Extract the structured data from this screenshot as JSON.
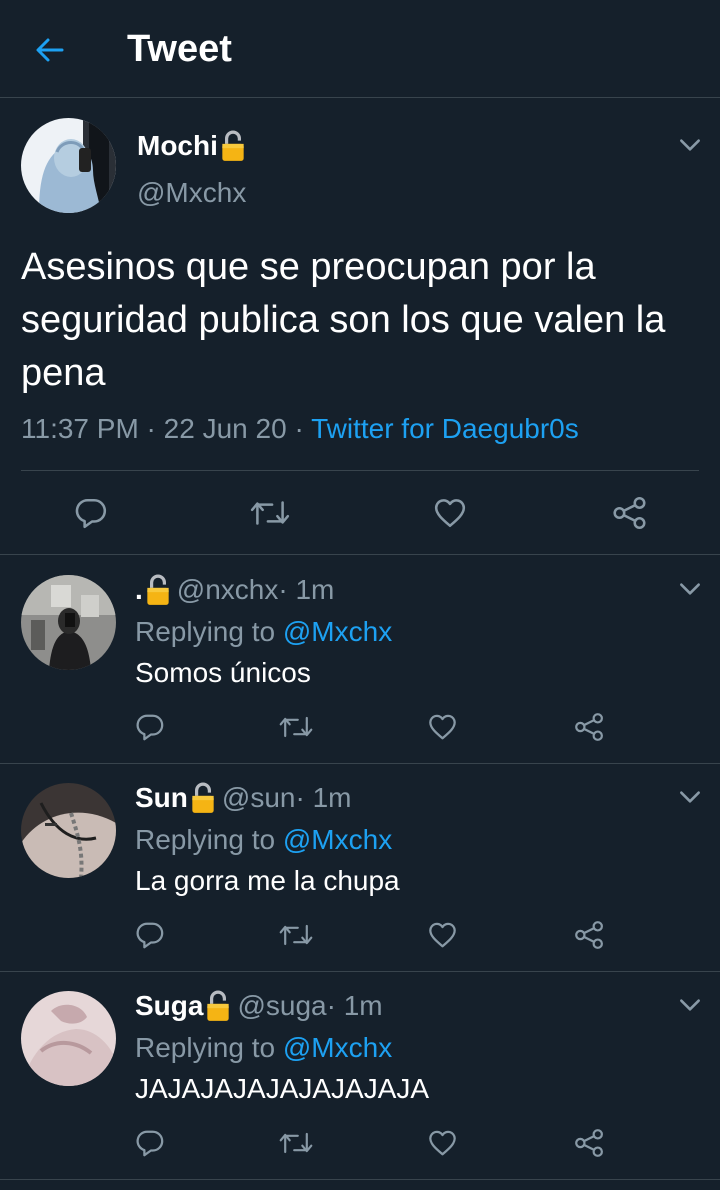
{
  "header": {
    "title": "Tweet",
    "back_icon": "arrow-left-icon"
  },
  "colors": {
    "background": "#15202b",
    "accent": "#1da1f2",
    "secondary_text": "#8899a6",
    "divider": "#38444d"
  },
  "main_tweet": {
    "name": "Mochi",
    "handle": "@Mxchx",
    "text": "Asesinos que se preocupan por la seguridad publica son los que valen la pena",
    "time": "11:37 PM",
    "sep1": " · ",
    "date": "22 Jun 20",
    "sep2": " · ",
    "source": "Twitter for Daegubr0s"
  },
  "replies": [
    {
      "name": ".",
      "handle": "@nxchx",
      "time": " · 1m",
      "replying_prefix": "Replying to ",
      "replying_to": "@Mxchx",
      "text": "Somos únicos"
    },
    {
      "name": "Sun",
      "handle": "@sun",
      "time": " · 1m",
      "replying_prefix": "Replying to ",
      "replying_to": "@Mxchx",
      "text": "La gorra me la chupa"
    },
    {
      "name": "Suga",
      "handle": "@suga",
      "time": " · 1m",
      "replying_prefix": "Replying to ",
      "replying_to": "@Mxchx",
      "text": "JAJAJAJAJAJAJAJAJA"
    }
  ]
}
